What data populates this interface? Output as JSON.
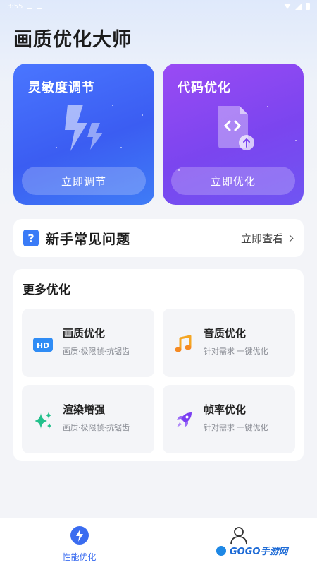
{
  "statusbar": {
    "time": "3:55"
  },
  "app": {
    "title": "画质优化大师"
  },
  "cards": [
    {
      "title": "灵敏度调节",
      "button": "立即调节",
      "icon": "lightning-bolt-icon",
      "color_start": "#4a76ff",
      "color_end": "#3f7cf6"
    },
    {
      "title": "代码优化",
      "button": "立即优化",
      "icon": "code-file-icon",
      "color_start": "#9a4bf4",
      "color_end": "#6f55f2"
    }
  ],
  "faq": {
    "icon": "question-mark",
    "title": "新手常见问题",
    "action": "立即查看"
  },
  "more": {
    "title": "更多优化",
    "items": [
      {
        "title": "画质优化",
        "subtitle": "画质·极限帧·抗锯齿",
        "icon": "hd-icon"
      },
      {
        "title": "音质优化",
        "subtitle": "针对需求 一键优化",
        "icon": "music-note-icon"
      },
      {
        "title": "渲染增强",
        "subtitle": "画质·极限帧·抗锯齿",
        "icon": "sparkle-icon"
      },
      {
        "title": "帧率优化",
        "subtitle": "针对需求 一键优化",
        "icon": "rocket-icon"
      }
    ]
  },
  "bottom_nav": [
    {
      "label": "性能优化",
      "icon": "bolt-circle-icon",
      "active": true
    },
    {
      "label": "",
      "icon": "person-icon",
      "active": false
    }
  ],
  "watermark": {
    "text": "GOGO手游网"
  },
  "colors": {
    "accent": "#3a6cf0",
    "faq_icon": "#3a7bf7"
  }
}
